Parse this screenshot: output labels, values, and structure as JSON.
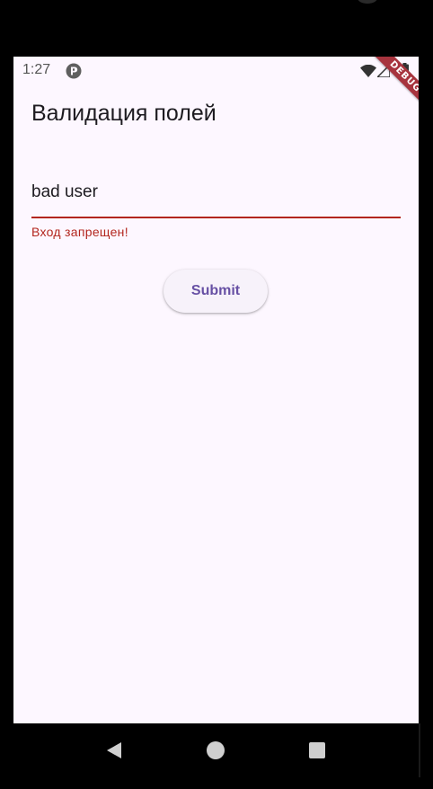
{
  "status_bar": {
    "time": "1:27",
    "icons": [
      "app-notification-icon",
      "wifi-icon",
      "signal-icon",
      "battery-icon"
    ]
  },
  "debug_banner": "DEBUG",
  "app_bar": {
    "title": "Валидация полей"
  },
  "form": {
    "input_value": "bad user",
    "error_message": "Вход запрещен!",
    "submit_label": "Submit"
  },
  "nav_bar": {
    "buttons": [
      "back-icon",
      "home-icon",
      "recents-icon"
    ]
  },
  "colors": {
    "background": "#fdf7ff",
    "error": "#b3261e",
    "accent": "#6750a4",
    "button_bg": "#f7f2fa",
    "debug_banner": "#a7343e"
  }
}
